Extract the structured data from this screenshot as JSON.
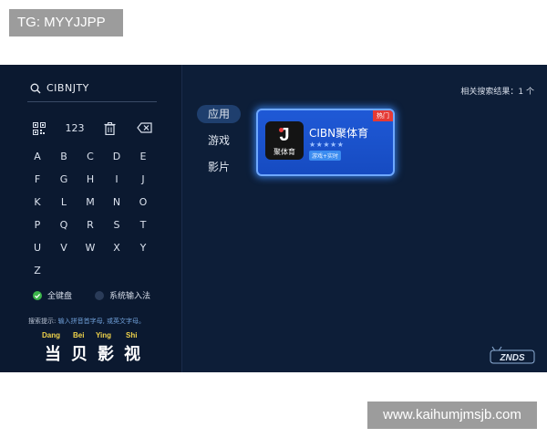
{
  "tg_label": "TG: MYYJJPP",
  "watermark": "www.kaihumjmsjb.com",
  "search": {
    "icon": "search-icon",
    "query": "CIBNJTY"
  },
  "toolbar": {
    "qr_icon": "qr-code-icon",
    "digits_label": "123",
    "clear_icon": "trash-icon",
    "backspace_icon": "backspace-icon"
  },
  "keyboard": {
    "keys": [
      "A",
      "B",
      "C",
      "D",
      "E",
      "F",
      "G",
      "H",
      "I",
      "J",
      "K",
      "L",
      "M",
      "N",
      "O",
      "P",
      "Q",
      "R",
      "S",
      "T",
      "U",
      "V",
      "W",
      "X",
      "Y",
      "Z"
    ]
  },
  "keyboard_modes": {
    "full": "全键盘",
    "system": "系统输入法"
  },
  "hint": {
    "prefix": "搜索提示:",
    "text": "输入拼音首字母, 或英文字母。"
  },
  "brand": {
    "pinyin": [
      "Dang",
      "Bei",
      "Ying",
      "Shi"
    ],
    "hanzi": [
      "当",
      "贝",
      "影",
      "视"
    ]
  },
  "categories": [
    {
      "label": "应用",
      "active": true
    },
    {
      "label": "游戏",
      "active": false
    },
    {
      "label": "影片",
      "active": false
    }
  ],
  "results_count": "相关搜索结果：1 个",
  "app_card": {
    "icon_letter": "J",
    "icon_label": "聚体育",
    "name": "CIBN聚体育",
    "stars": "★★★★★",
    "tag": "游戏+实时",
    "hot_badge": "热门"
  },
  "znds_logo": "ZNDS",
  "colors": {
    "tv_bg": "#0d1e38",
    "card_blue": "#1f59d6",
    "glow": "#6ea8ff",
    "hot_red": "#e53a35",
    "pinyin_yellow": "#f0d34a",
    "check_green": "#3bb54a"
  }
}
